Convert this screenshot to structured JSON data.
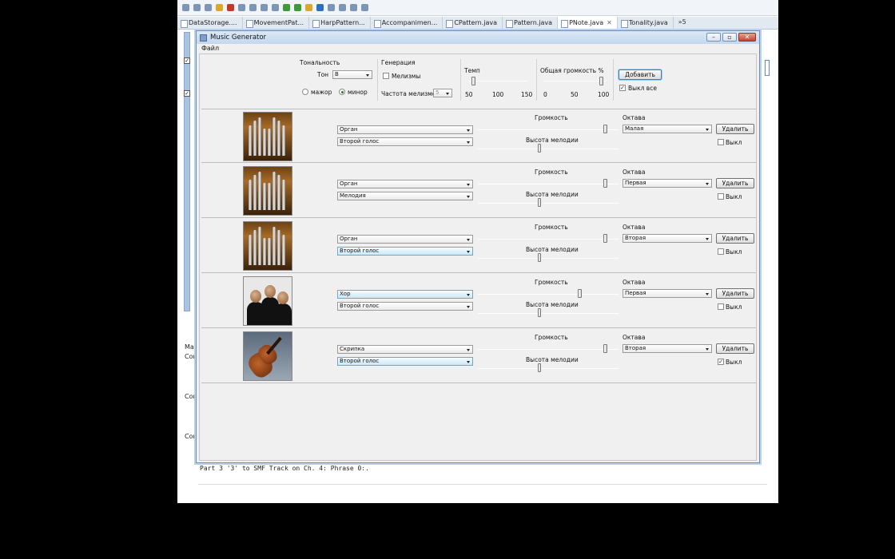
{
  "ide": {
    "tabs": [
      {
        "label": "DataStorage...."
      },
      {
        "label": "MovementPat..."
      },
      {
        "label": "HarpPattern..."
      },
      {
        "label": "Accompanimen..."
      },
      {
        "label": "CPattern.java"
      },
      {
        "label": "Pattern.java"
      },
      {
        "label": "PNote.java",
        "active": true,
        "close": "✕"
      },
      {
        "label": "Tonality.java"
      }
    ],
    "tab_overflow": "»5",
    "console_side": {
      "header": "Mai",
      "lines": [
        "Con",
        "Con",
        "Con"
      ]
    },
    "console_line": "Part 3 '3' to SMF Track on Ch. 4:  Phrase 0:."
  },
  "dialog": {
    "title": "Music Generator",
    "menu": "Файл",
    "close_glyph": "✕",
    "tonality": {
      "group_label": "Тональность",
      "tone_label": "Тон",
      "tone_value": "B",
      "major_label": "мажор",
      "minor_label": "минор",
      "minor_selected": true
    },
    "generation": {
      "group_label": "Генерация",
      "melisma_label": "Мелизмы",
      "melisma_checked": false,
      "freq_label": "Частота мелизмов",
      "freq_value": "5"
    },
    "tempo": {
      "label": "Темп",
      "ticks": [
        "50",
        "100",
        "150"
      ],
      "value": 50
    },
    "volume": {
      "label": "Общая громкость %",
      "ticks": [
        "0",
        "50",
        "100"
      ],
      "value": 100
    },
    "add_button": "Добавить",
    "mute_all_label": "Выкл все",
    "mute_all_checked": true,
    "track_labels": {
      "volume": "Громкость",
      "pitch": "Высота мелодии",
      "octave": "Октава",
      "delete": "Удалить",
      "mute": "Выкл"
    },
    "tracks": [
      {
        "image": "organ-image",
        "instrument": "Орган",
        "voice": "Второй голос",
        "octave": "Малая",
        "muted": false,
        "volume": 0.92,
        "pitch": 0.5,
        "hl_inst": false,
        "hl_voice": false
      },
      {
        "image": "organ-image",
        "instrument": "Орган",
        "voice": "Мелодия",
        "octave": "Первая",
        "muted": false,
        "volume": 0.92,
        "pitch": 0.5,
        "hl_inst": false,
        "hl_voice": false
      },
      {
        "image": "organ-image",
        "instrument": "Орган",
        "voice": "Второй голос",
        "octave": "Вторая",
        "muted": false,
        "volume": 0.92,
        "pitch": 0.5,
        "hl_inst": false,
        "hl_voice": true
      },
      {
        "image": "choir-image",
        "instrument": "Хор",
        "voice": "Второй голос",
        "octave": "Первая",
        "muted": false,
        "volume": 0.73,
        "pitch": 0.5,
        "hl_inst": true,
        "hl_voice": false
      },
      {
        "image": "violin-image",
        "instrument": "Скрипка",
        "voice": "Второй голос",
        "octave": "Вторая",
        "muted": true,
        "volume": 0.92,
        "pitch": 0.5,
        "hl_inst": false,
        "hl_voice": true
      }
    ]
  }
}
